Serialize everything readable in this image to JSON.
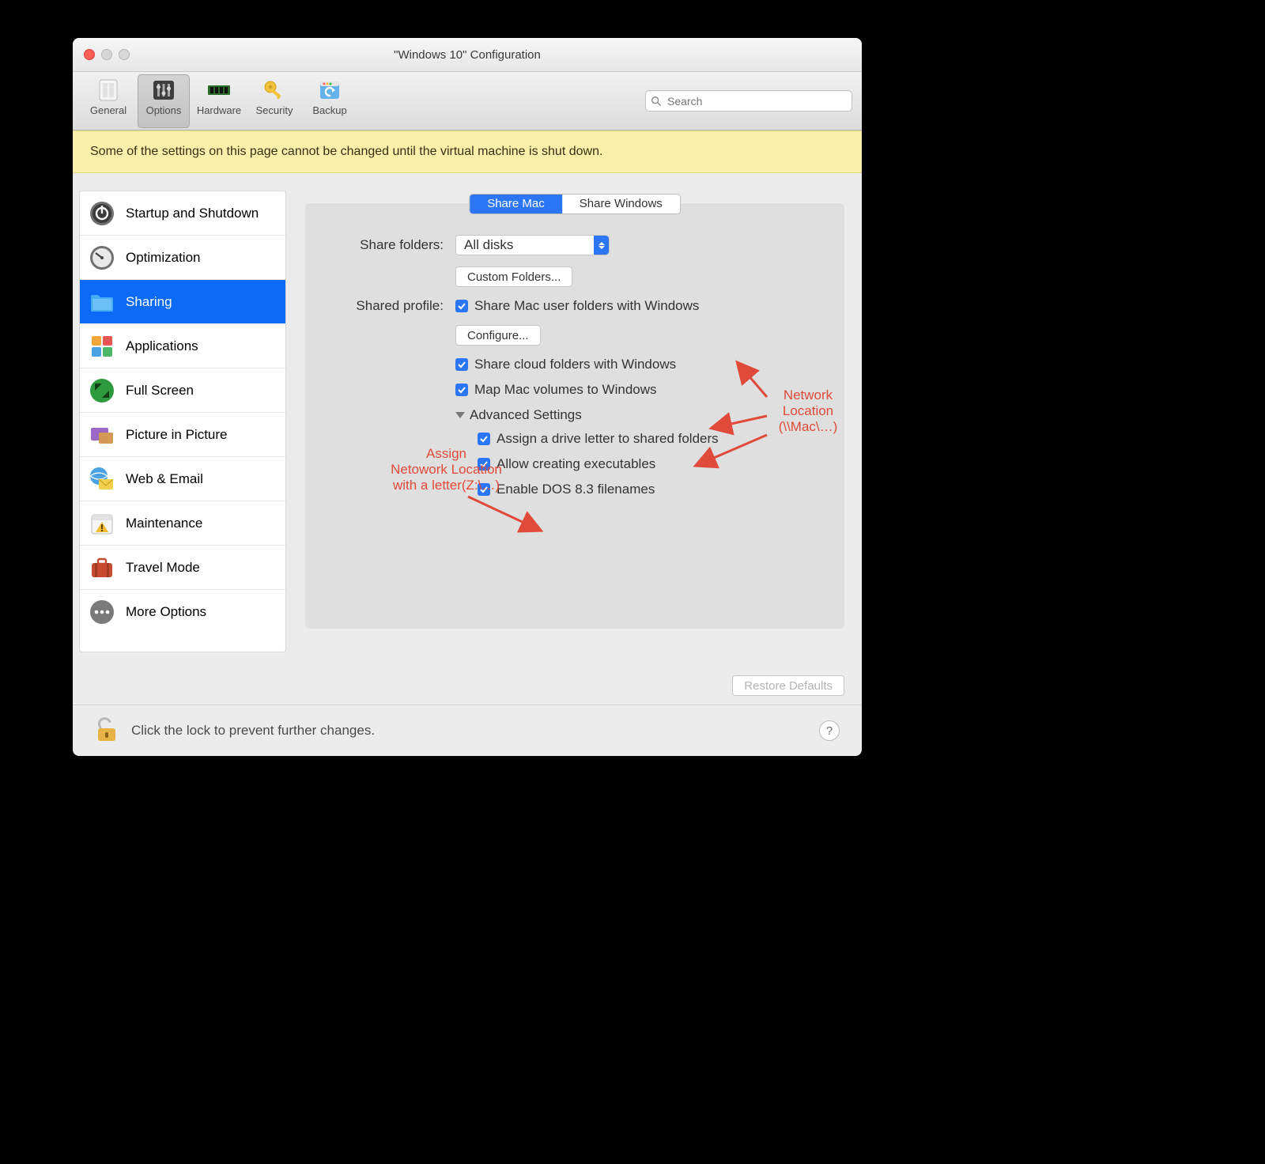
{
  "window": {
    "title": "\"Windows 10\" Configuration"
  },
  "toolbar": {
    "items": [
      {
        "id": "general",
        "label": "General"
      },
      {
        "id": "options",
        "label": "Options"
      },
      {
        "id": "hardware",
        "label": "Hardware"
      },
      {
        "id": "security",
        "label": "Security"
      },
      {
        "id": "backup",
        "label": "Backup"
      }
    ],
    "search_placeholder": "Search"
  },
  "banner": "Some of the settings on this page cannot be changed until the virtual machine is shut down.",
  "sidebar": {
    "items": [
      {
        "id": "startup",
        "label": "Startup and Shutdown"
      },
      {
        "id": "optimization",
        "label": "Optimization"
      },
      {
        "id": "sharing",
        "label": "Sharing"
      },
      {
        "id": "applications",
        "label": "Applications"
      },
      {
        "id": "fullscreen",
        "label": "Full Screen"
      },
      {
        "id": "pip",
        "label": "Picture in Picture"
      },
      {
        "id": "web",
        "label": "Web & Email"
      },
      {
        "id": "maintenance",
        "label": "Maintenance"
      },
      {
        "id": "travel",
        "label": "Travel Mode"
      },
      {
        "id": "more",
        "label": "More Options"
      }
    ]
  },
  "segment": {
    "share_mac": "Share Mac",
    "share_windows": "Share Windows"
  },
  "form": {
    "share_folders_label": "Share folders:",
    "share_folders_value": "All disks",
    "custom_folders_button": "Custom Folders...",
    "shared_profile_label": "Shared profile:",
    "share_user_folders": "Share Mac user folders with Windows",
    "configure_button": "Configure...",
    "share_cloud": "Share cloud folders with Windows",
    "map_volumes": "Map Mac volumes to Windows",
    "advanced_label": "Advanced Settings",
    "adv_drive_letter": "Assign a drive letter to shared folders",
    "adv_executables": "Allow creating executables",
    "adv_dos83": "Enable DOS 8.3 filenames"
  },
  "restore_defaults": "Restore Defaults",
  "footer": {
    "lock_text": "Click the lock to prevent further changes."
  },
  "annotations": {
    "left": "Assign\nNetowork Location\nwith a letter(Z:\\…)",
    "right": "Network\nLocation\n(\\\\Mac\\…)"
  }
}
